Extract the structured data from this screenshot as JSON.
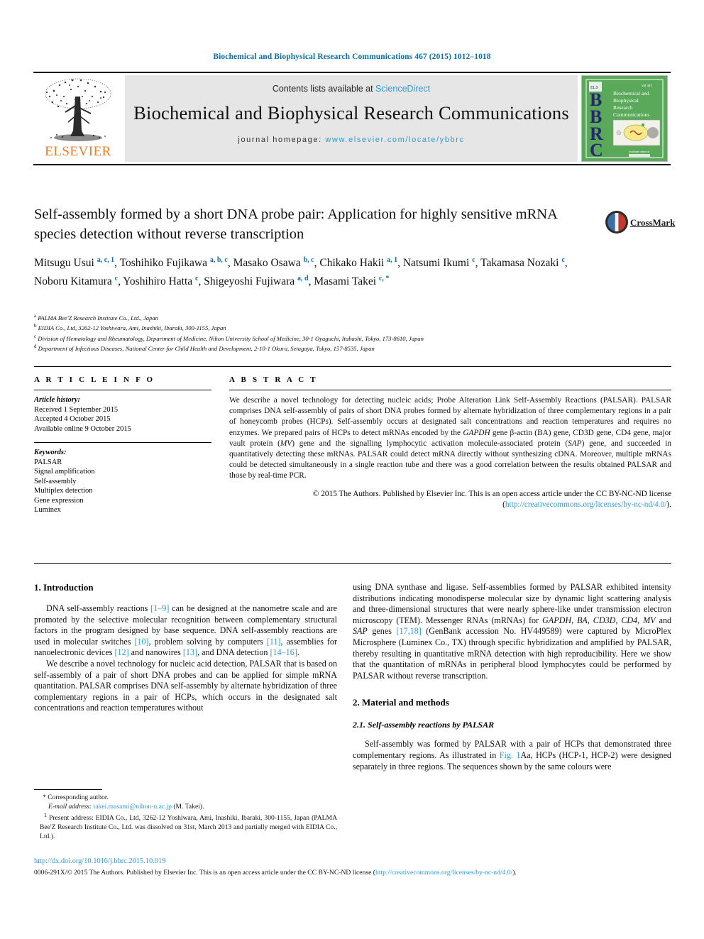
{
  "running_head": "Biochemical and Biophysical Research Communications 467 (2015) 1012–1018",
  "masthead": {
    "contents_prefix": "Contents lists available at ",
    "contents_link": "ScienceDirect",
    "journal_title": "Biochemical and Biophysical Research Communications",
    "homepage_prefix": "journal homepage: ",
    "homepage_url": "www.elsevier.com/locate/ybbrc",
    "publisher_word": "ELSEVIER",
    "cover_letters": "BBRC",
    "cover_title": "Biochemical and Biophysical Research Communications"
  },
  "crossmark": {
    "label": "CrossMark"
  },
  "article": {
    "title": "Self-assembly formed by a short DNA probe pair: Application for highly sensitive mRNA species detection without reverse transcription",
    "authors_html": "Mitsugu Usui <sup>a, c, 1</sup>, Toshihiko Fujikawa <sup>a, b, c</sup>, Masako Osawa <sup>b, c</sup>, Chikako Hakii <sup>a, 1</sup>, Natsumi Ikumi <sup>c</sup>, Takamasa Nozaki <sup>c</sup>, Noboru Kitamura <sup>c</sup>, Yoshihiro Hatta <sup>c</sup>, Shigeyoshi Fujiwara <sup>a, d</sup>, Masami Takei <sup>c, *</sup>",
    "affiliations": [
      {
        "mark": "a",
        "text": "PALMA Bee'Z Research Institute Co., Ltd., Japan"
      },
      {
        "mark": "b",
        "text": "EIDIA Co., Ltd, 3262-12 Yoshiwara, Ami, Inashiki, Ibaraki, 300-1155, Japan"
      },
      {
        "mark": "c",
        "text": "Division of Hematology and Rheumatology, Department of Medicine, Nihon University School of Medicine, 30-1 Oyaguchi, Itabashi, Tokyo, 173-8610, Japan"
      },
      {
        "mark": "d",
        "text": "Department of Infectious Diseases, National Center for Child Health and Development, 2-10-1 Okura, Setagaya, Tokyo, 157-8535, Japan"
      }
    ]
  },
  "article_info": {
    "heading": "A R T I C L E   I N F O",
    "history_label": "Article history:",
    "history": [
      "Received 1 September 2015",
      "Accepted 4 October 2015",
      "Available online 9 October 2015"
    ],
    "keywords_label": "Keywords:",
    "keywords": [
      "PALSAR",
      "Signal amplification",
      "Self-assembly",
      "Multiplex detection",
      "Gene expression",
      "Luminex"
    ]
  },
  "abstract": {
    "heading": "A B S T R A C T",
    "paragraph_html": "We describe a novel technology for detecting nucleic acids; Probe Alteration Link Self-Assembly Reactions (PALSAR). PALSAR comprises DNA self-assembly of pairs of short DNA probes formed by alternate hybridization of three complementary regions in a pair of honeycomb probes (HCPs). Self-assembly occurs at designated salt concentrations and reaction temperatures and requires no enzymes. We prepared pairs of HCPs to detect mRNAs encoded by the <span class=\"i\">GAPDH</span> gene β-actin (BA) gene, CD3D gene, CD4 gene, major vault protein (<span class=\"i\">MV</span>) gene and the signalling lymphocytic activation molecule-associated protein (<span class=\"i\">SAP</span>) gene, and succeeded in quantitatively detecting these mRNAs. PALSAR could detect mRNA directly without synthesizing cDNA. Moreover, multiple mRNAs could be detected simultaneously in a single reaction tube and there was a good correlation between the results obtained PALSAR and those by real-time PCR.",
    "copyright_html": "© 2015 The Authors. Published by Elsevier Inc. This is an open access article under the CC BY-NC-ND license (<a href=\"#\">http://creativecommons.org/licenses/by-nc-nd/4.0/</a>)."
  },
  "sections": {
    "introduction": {
      "heading": "1.  Introduction",
      "paragraphs_html": [
        "DNA self-assembly reactions <span class=\"ref\">[1–9]</span> can be designed at the nanometre scale and are promoted by the selective molecular recognition between complementary structural factors in the program designed by base sequence. DNA self-assembly reactions are used in molecular switches <span class=\"ref\">[10]</span>, problem solving by computers <span class=\"ref\">[11]</span>, assemblies for nanoelectronic devices <span class=\"ref\">[12]</span> and nanowires <span class=\"ref\">[13]</span>, and DNA detection <span class=\"ref\">[14–16]</span>.",
        "We describe a novel technology for nucleic acid detection, PALSAR that is based on self-assembly of a pair of short DNA probes and can be applied for simple mRNA quantitation. PALSAR comprises DNA self-assembly by alternate hybridization of three complementary regions in a pair of HCPs, which occurs in the designated salt concentrations and reaction temperatures without",
        "using DNA synthase and ligase. Self-assemblies formed by PALSAR exhibited intensity distributions indicating monodisperse molecular size by dynamic light scattering analysis and three-dimensional structures that were nearly sphere-like under transmission electron microscopy (TEM). Messenger RNAs (mRNAs) for <span class=\"gene\">GAPDH</span>, <span class=\"gene\">BA</span>, <span class=\"gene\">CD3D</span>, <span class=\"gene\">CD4</span>, <span class=\"gene\">MV</span> and <span class=\"gene\">SAP</span> genes <span class=\"ref\">[17,18]</span> (GenBank accession No. HV449589) were captured by MicroPlex Microsphere (Luminex Co., TX) through specific hybridization and amplified by PALSAR, thereby resulting in quantitative mRNA detection with high reproducibility. Here we show that the quantitation of mRNAs in peripheral blood lymphocytes could be performed by PALSAR without reverse transcription."
      ]
    },
    "methods": {
      "heading": "2.  Material and methods",
      "subheading": "2.1.  Self-assembly reactions by PALSAR",
      "paragraph_html": "Self-assembly was formed by PALSAR with a pair of HCPs that demonstrated three complementary regions. As illustrated in <span class=\"figref\">Fig. 1</span>Aa, HCPs (HCP-1, HCP-2) were designed separately in three regions. The sequences shown by the same colours were"
    }
  },
  "footnotes": {
    "corresponding_html": "* Corresponding author.",
    "email_html": "<span class=\"em\">E-mail address:</span> <a href=\"#\">takei.masami@nihon-u.ac.jp</a> (M. Takei).",
    "present_address_html": "<sup>1</sup>  Present address: EIDIA Co., Ltd, 3262-12 Yoshiwara, Ami, Inashiki, Ibaraki, 300-1155, Japan (PALMA Bee'Z Research Institute Co., Ltd. was dissolved on 31st, March 2013 and partially merged with EIDIA Co., Ltd.)."
  },
  "bottom": {
    "doi": "http://dx.doi.org/10.1016/j.bbrc.2015.10.019",
    "issn_html": "0006-291X/© 2015 The Authors. Published by Elsevier Inc. This is an open access article under the CC BY-NC-ND license (<a href=\"#\">http://creativecommons.org/licenses/by-nc-nd/4.0/</a>)."
  },
  "colors": {
    "link": "#2e9bd6",
    "running_head": "#0a6fa8",
    "elsevier_orange": "#f47b20",
    "cover_green": "#4fa34f"
  }
}
